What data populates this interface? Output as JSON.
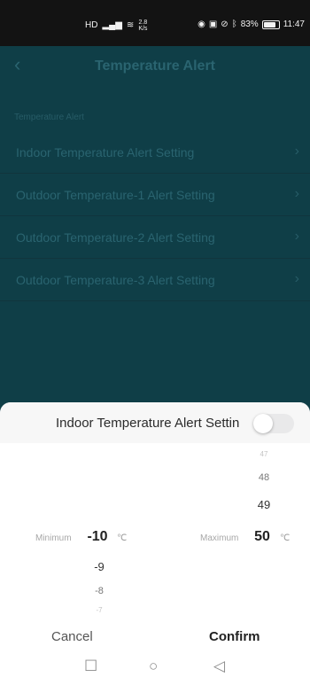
{
  "status_bar": {
    "hd": "HD",
    "network_speed": "2.8\nK/s",
    "battery": "83%",
    "battery_level": 0.83,
    "time": "11:47"
  },
  "nav": {
    "title": "Temperature Alert",
    "back_glyph": "‹"
  },
  "section_label": "Temperature Alert",
  "items": [
    {
      "label": "Indoor Temperature Alert Setting"
    },
    {
      "label": "Outdoor Temperature-1 Alert Setting"
    },
    {
      "label": "Outdoor Temperature-2 Alert Setting"
    },
    {
      "label": "Outdoor Temperature-3 Alert Setting"
    }
  ],
  "sheet": {
    "title": "Indoor Temperature Alert Settin",
    "toggle_on": false,
    "min_label": "Minimum",
    "max_label": "Maximum",
    "unit": "℃",
    "min_selected": "-10",
    "min_values": [
      "-9",
      "-8",
      "-7"
    ],
    "max_selected": "50",
    "max_values": [
      "47",
      "48",
      "49"
    ],
    "cancel": "Cancel",
    "confirm": "Confirm"
  },
  "android_nav": {
    "recent": "☐",
    "home": "○",
    "back": "◁"
  }
}
